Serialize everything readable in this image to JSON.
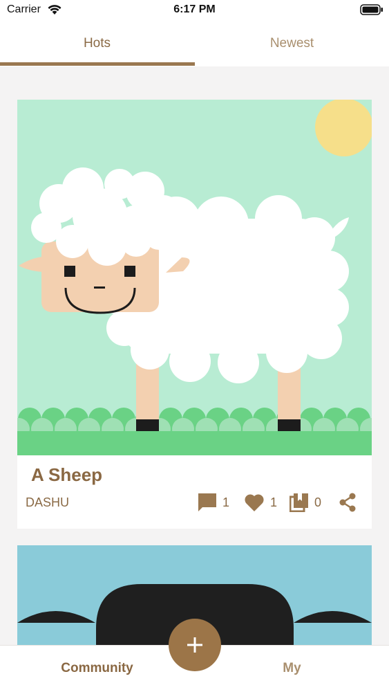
{
  "status_bar": {
    "carrier": "Carrier",
    "time": "6:17 PM",
    "icons": [
      "wifi-icon",
      "battery-icon"
    ]
  },
  "tabs": [
    {
      "label": "Hots",
      "active": true
    },
    {
      "label": "Newest",
      "active": false
    }
  ],
  "feed": {
    "posts": [
      {
        "title": "A Sheep",
        "author": "DASHU",
        "comments": "1",
        "likes": "1",
        "collections": "0",
        "icons": [
          "comment-icon",
          "heart-icon",
          "collection-icon",
          "share-icon"
        ]
      }
    ]
  },
  "bottom_nav": {
    "items": [
      {
        "label": "Community",
        "active": true
      },
      {
        "label": "My",
        "active": false
      }
    ],
    "fab_icon": "plus-icon"
  },
  "colors": {
    "accent": "#9a7850",
    "accent_text": "#8a6843",
    "inactive_text": "#a98f6e",
    "background": "#f4f3f3",
    "artwork_sky": "#b8ecd3",
    "artwork_grass": "#6ad285",
    "artwork_sun": "#f6df8a",
    "artwork_skin": "#f3d0b0",
    "card2_sky": "#8acbd9"
  }
}
